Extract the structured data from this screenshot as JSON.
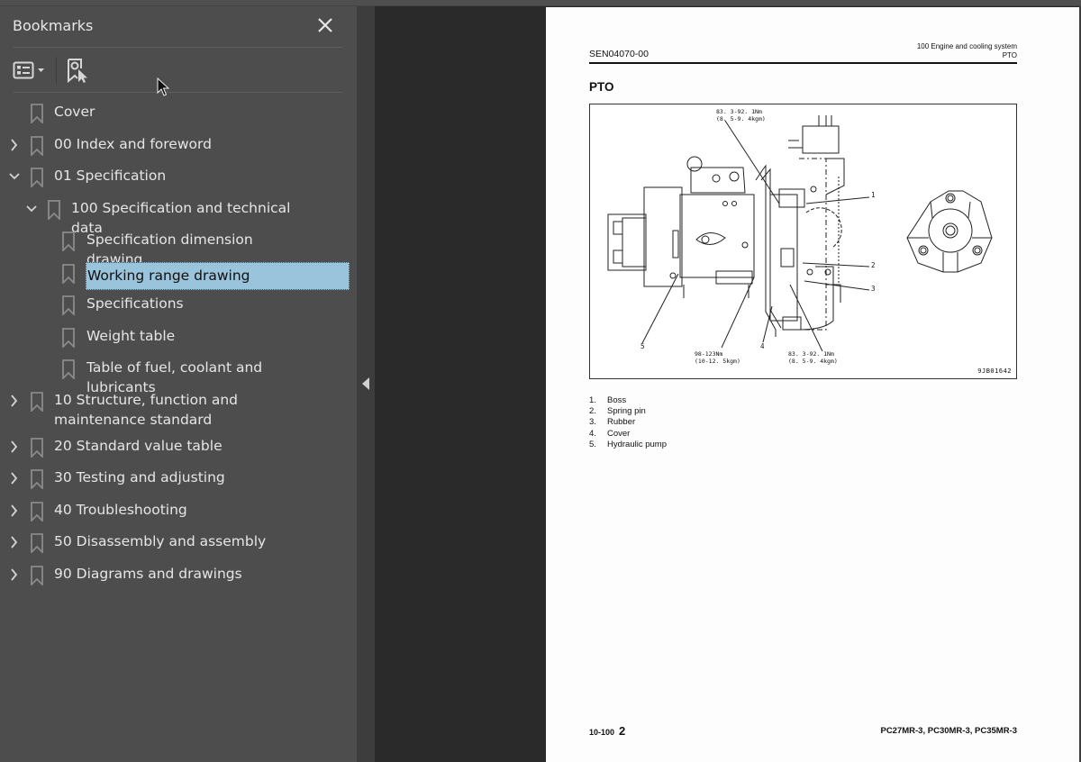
{
  "sidebar": {
    "title": "Bookmarks",
    "close_icon": "close-icon",
    "toolbar": {
      "options_icon": "list-options-icon",
      "find_icon": "find-current-bookmark-icon"
    },
    "items": [
      {
        "label": "Cover",
        "level": 0,
        "expander": "none"
      },
      {
        "label": "00 Index and foreword",
        "level": 0,
        "expander": "collapsed"
      },
      {
        "label": "01 Specification",
        "level": 0,
        "expander": "expanded"
      },
      {
        "label": "100 Specification and technical data",
        "level": 1,
        "expander": "expanded"
      },
      {
        "label": "Specification dimension drawing",
        "level": 2,
        "expander": "none"
      },
      {
        "label": "Working range drawing",
        "level": 2,
        "expander": "none",
        "selected": true
      },
      {
        "label": "Specifications",
        "level": 2,
        "expander": "none"
      },
      {
        "label": "Weight table",
        "level": 2,
        "expander": "none"
      },
      {
        "label": "Table of fuel, coolant and lubricants",
        "level": 2,
        "expander": "none"
      },
      {
        "label": "10 Structure, function and maintenance standard",
        "level": 0,
        "expander": "collapsed"
      },
      {
        "label": "20 Standard value table",
        "level": 0,
        "expander": "collapsed"
      },
      {
        "label": "30 Testing and adjusting",
        "level": 0,
        "expander": "collapsed"
      },
      {
        "label": "40 Troubleshooting",
        "level": 0,
        "expander": "collapsed"
      },
      {
        "label": "50 Disassembly and assembly",
        "level": 0,
        "expander": "collapsed"
      },
      {
        "label": "90 Diagrams and drawings",
        "level": 0,
        "expander": "collapsed"
      }
    ]
  },
  "colors": {
    "sidebar_bg": "#4d4d4d",
    "viewer_bg": "#2a2a2a",
    "selection_bg": "#9ac3dc",
    "page_bg": "#fdfdfd"
  },
  "document": {
    "header_left": "SEN04070-00",
    "header_right_line1": "100 Engine and cooling system",
    "header_right_line2": "PTO",
    "title": "PTO",
    "figure": {
      "code": "9JB01642",
      "torque_top_line1": "83. 3-92. 1Nm",
      "torque_top_line2": "(8. 5-9. 4kgm)",
      "torque_bottom_left_line1": "98-123Nm",
      "torque_bottom_left_line2": "(10-12. 5kgm)",
      "torque_bottom_right_line1": "83. 3-92. 1Nm",
      "torque_bottom_right_line2": "(8. 5-9. 4kgm)",
      "callouts": [
        "1",
        "2",
        "3",
        "4",
        "5"
      ]
    },
    "legend": [
      {
        "num": "1.",
        "text": "Boss"
      },
      {
        "num": "2.",
        "text": "Spring pin"
      },
      {
        "num": "3.",
        "text": "Rubber"
      },
      {
        "num": "4.",
        "text": "Cover"
      },
      {
        "num": "5.",
        "text": "Hydraulic pump"
      }
    ],
    "footer_section": "10-100",
    "footer_page": "2",
    "footer_models": "PC27MR-3, PC30MR-3, PC35MR-3"
  }
}
